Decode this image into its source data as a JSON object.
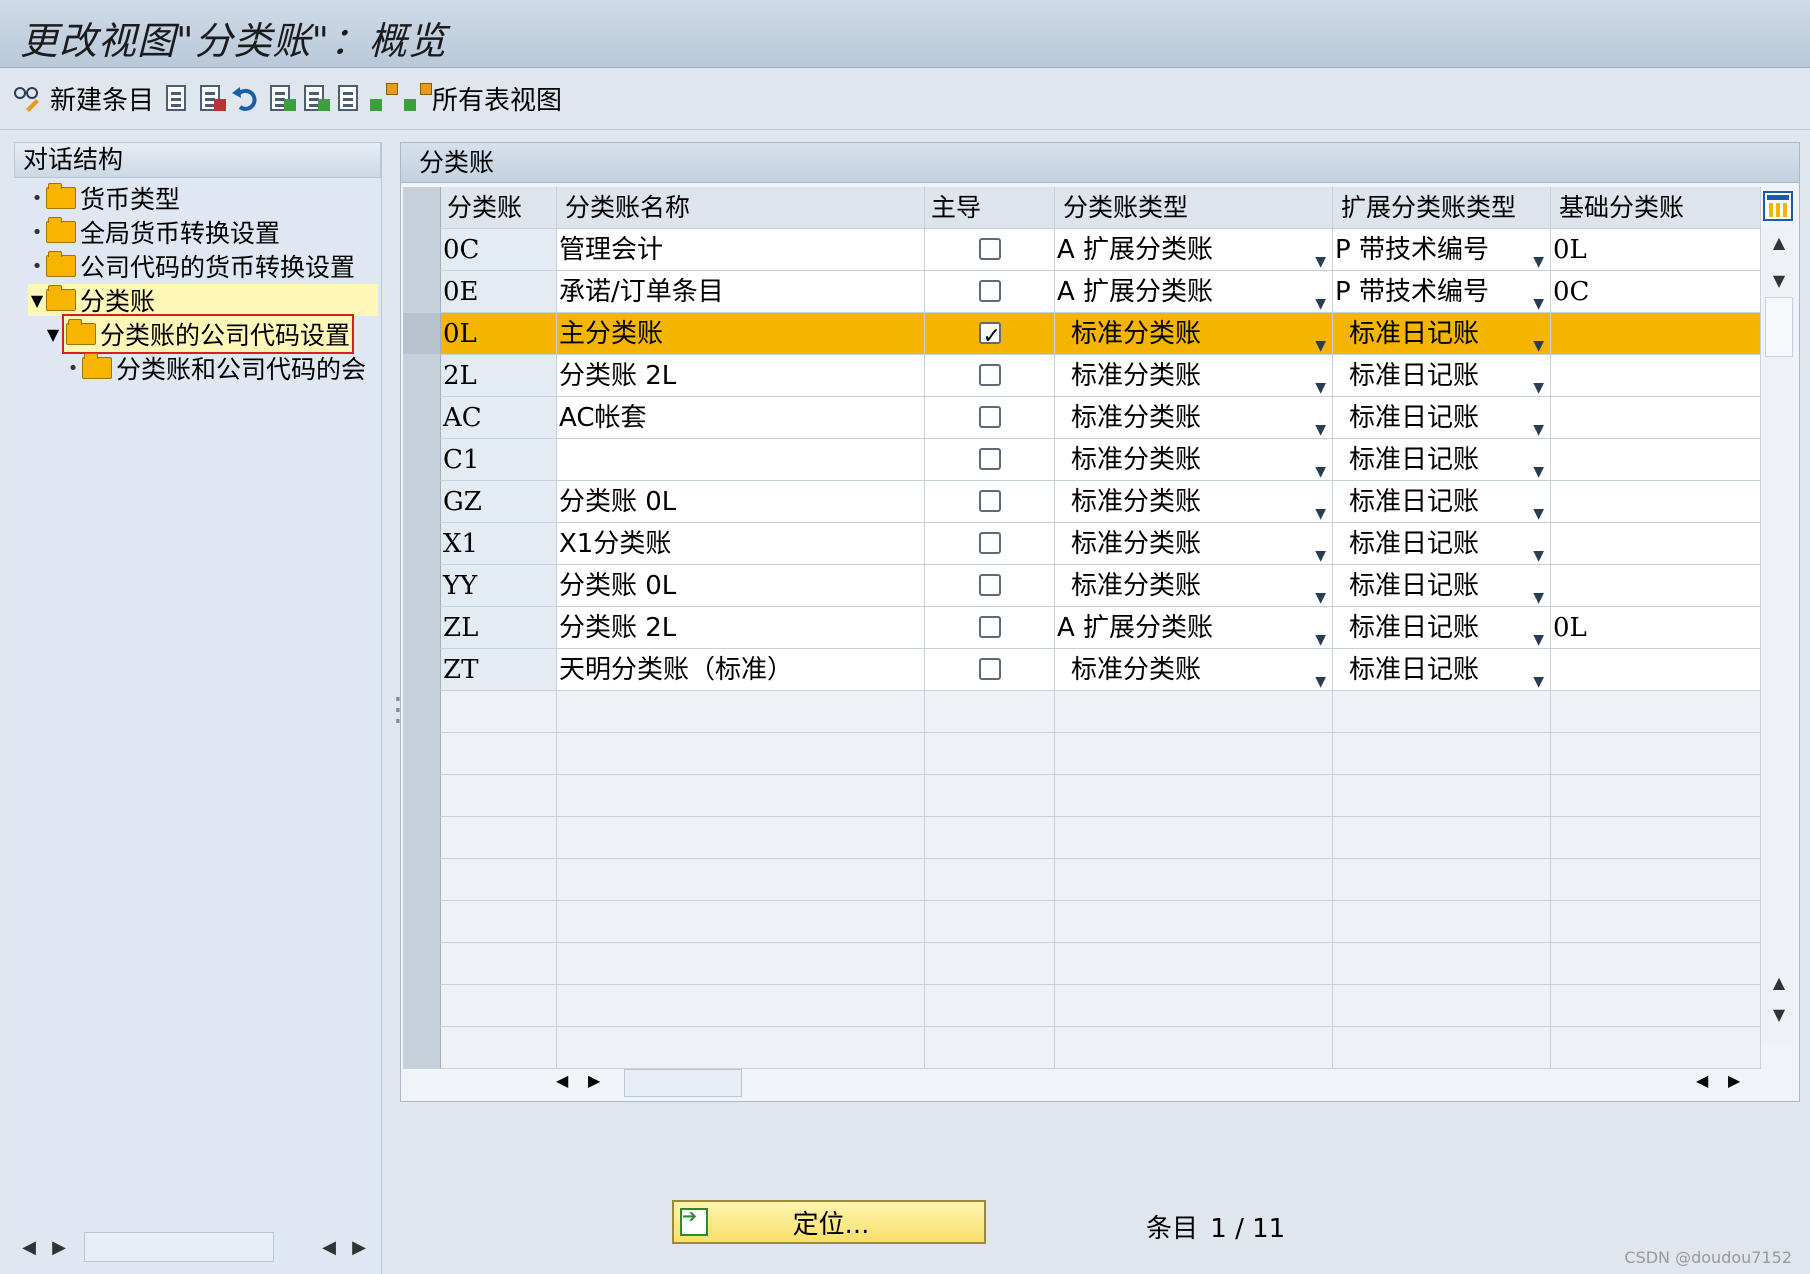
{
  "window": {
    "title": "更改视图\"分类账\"：概览"
  },
  "toolbar": {
    "new_entry_label": "新建条目",
    "all_tables_label": "所有表视图"
  },
  "left_panel": {
    "header": "对话结构",
    "items": [
      {
        "label": "货币类型"
      },
      {
        "label": "全局货币转换设置"
      },
      {
        "label": "公司代码的货币转换设置"
      },
      {
        "label": "分类账"
      },
      {
        "label": "分类账的公司代码设置"
      },
      {
        "label": "分类账和公司代码的会"
      }
    ]
  },
  "table": {
    "title": "分类账",
    "columns": [
      "分类账",
      "分类账名称",
      "主导",
      "分类账类型",
      "扩展分类账类型",
      "基础分类账"
    ],
    "rows": [
      {
        "ledger": "0C",
        "name": "管理会计",
        "leading": false,
        "type": "A 扩展分类账",
        "ext_type": "P 带技术编号",
        "base": "0L"
      },
      {
        "ledger": "0E",
        "name": "承诺/订单条目",
        "leading": false,
        "type": "A 扩展分类账",
        "ext_type": "P 带技术编号",
        "base": "0C"
      },
      {
        "ledger": "0L",
        "name": "主分类账",
        "leading": true,
        "type": "标准分类账",
        "ext_type": "标准日记账",
        "base": ""
      },
      {
        "ledger": "2L",
        "name": "分类账 2L",
        "leading": false,
        "type": "标准分类账",
        "ext_type": "标准日记账",
        "base": ""
      },
      {
        "ledger": "AC",
        "name": "AC帐套",
        "leading": false,
        "type": "标准分类账",
        "ext_type": "标准日记账",
        "base": ""
      },
      {
        "ledger": "C1",
        "name": "",
        "leading": false,
        "type": "标准分类账",
        "ext_type": "标准日记账",
        "base": ""
      },
      {
        "ledger": "GZ",
        "name": "分类账 0L",
        "leading": false,
        "type": "标准分类账",
        "ext_type": "标准日记账",
        "base": ""
      },
      {
        "ledger": "X1",
        "name": "X1分类账",
        "leading": false,
        "type": "标准分类账",
        "ext_type": "标准日记账",
        "base": ""
      },
      {
        "ledger": "YY",
        "name": "分类账 0L",
        "leading": false,
        "type": "标准分类账",
        "ext_type": "标准日记账",
        "base": ""
      },
      {
        "ledger": "ZL",
        "name": "分类账 2L",
        "leading": false,
        "type": "A 扩展分类账",
        "ext_type": "标准日记账",
        "base": "0L"
      },
      {
        "ledger": "ZT",
        "name": "天明分类账（标准）",
        "leading": false,
        "type": "标准分类账",
        "ext_type": "标准日记账",
        "base": ""
      }
    ]
  },
  "footer": {
    "position_button": "定位...",
    "entry_label": "条目",
    "entry_value": "1 / 11",
    "watermark": "CSDN @doudou7152"
  },
  "colors": {
    "highlight": "#f5b400",
    "folder": "#f7b500"
  }
}
